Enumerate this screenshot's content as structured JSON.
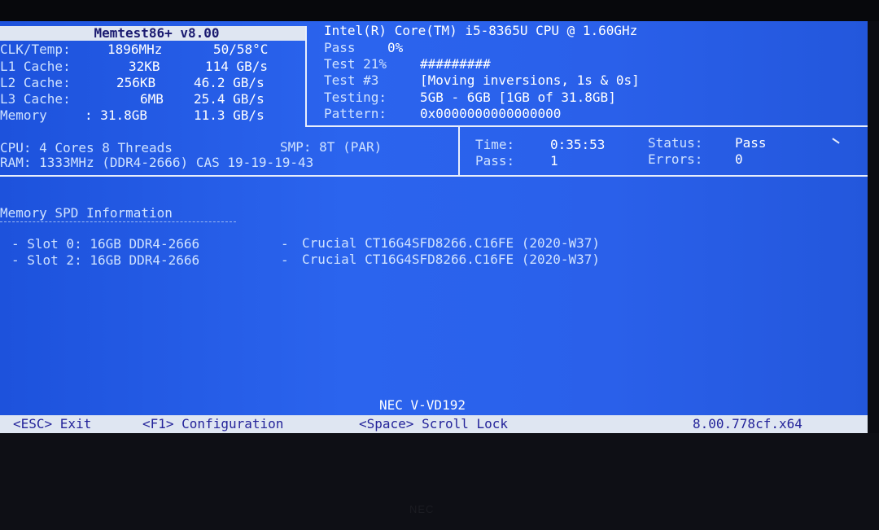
{
  "header": {
    "title": "Memtest86+ v8.00"
  },
  "cpu_info": {
    "name": "Intel(R) Core(TM) i5-8365U CPU @ 1.60GHz",
    "pass_label": "Pass",
    "pass_pct": "0%",
    "test_label": "Test 21%",
    "test_bar": "#########",
    "testno_label": "Test #3",
    "testno_desc": "[Moving inversions, 1s & 0s]",
    "testing_label": "Testing:",
    "testing_val": "5GB - 6GB [1GB of 31.8GB]",
    "pattern_label": "Pattern:",
    "pattern_val": "0x0000000000000000"
  },
  "stats": {
    "clk": {
      "label": "CLK/Temp:",
      "v1": "1896MHz",
      "v2": "50/58°C"
    },
    "l1": {
      "label": "L1 Cache:",
      "v1": "32KB",
      "v2": "114 GB/s"
    },
    "l2": {
      "label": "L2 Cache:",
      "v1": "256KB",
      "v2": "46.2 GB/s"
    },
    "l3": {
      "label": "L3 Cache:",
      "v1": "6MB",
      "v2": "25.4 GB/s"
    },
    "mem": {
      "label": "Memory",
      "v1": ": 31.8GB",
      "v2": "11.3 GB/s"
    }
  },
  "system": {
    "cpu_line": "CPU: 4 Cores 8 Threads",
    "smp_line": "SMP: 8T (PAR)",
    "ram_line": "RAM: 1333MHz (DDR4-2666) CAS 19-19-19-43",
    "time_label": "Time:",
    "time_val": "0:35:53",
    "pass_label": "Pass:",
    "pass_val": "1",
    "status_label": "Status:",
    "status_val": "Pass",
    "errors_label": "Errors:",
    "errors_val": "0"
  },
  "spd": {
    "title": "Memory SPD Information",
    "slots": [
      {
        "slot": "- Slot 0: 16GB DDR4-2666",
        "sep": "-",
        "module": "Crucial CT16G4SFD8266.C16FE (2020-W37)"
      },
      {
        "slot": "- Slot 2: 16GB DDR4-2666",
        "sep": "-",
        "module": "Crucial CT16G4SFD8266.C16FE (2020-W37)"
      }
    ]
  },
  "display_name": "NEC V-VD192",
  "footer": {
    "esc": "<ESC> Exit",
    "f1": "<F1> Configuration",
    "space": "<Space> Scroll Lock",
    "version": "8.00.778cf.x64"
  },
  "bezel_brand": "NEC"
}
